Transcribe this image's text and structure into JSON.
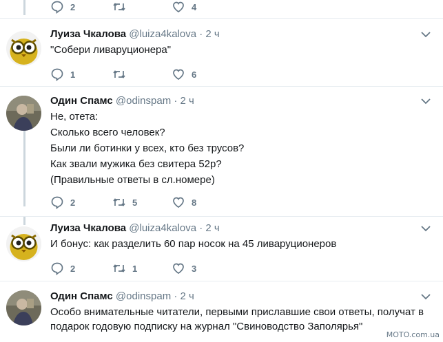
{
  "top_actions": {
    "replies": "2",
    "retweets": "",
    "likes": "4"
  },
  "tweets": [
    {
      "name": "Луиза Чкалова",
      "handle": "@luiza4kalova",
      "dot": "·",
      "time": "2 ч",
      "lines": [
        "\"Собери ливаруционера\""
      ],
      "replies": "1",
      "retweets": "",
      "likes": "6",
      "avatar": "owl-avatar"
    },
    {
      "name": "Один Спамс",
      "handle": "@odinspam",
      "dot": "·",
      "time": "2 ч",
      "lines": [
        "Не, отета:",
        "Сколько всего человек?",
        "Были ли ботинки у всех, кто без трусов?",
        "Как звали мужика без свитера 52р?",
        "(Правильные ответы в сл.номере)"
      ],
      "replies": "2",
      "retweets": "5",
      "likes": "8",
      "avatar": "painting-avatar"
    },
    {
      "name": "Луиза Чкалова",
      "handle": "@luiza4kalova",
      "dot": "·",
      "time": "2 ч",
      "lines": [
        "И бонус: как разделить 60 пар носок на 45 ливаруционеров"
      ],
      "replies": "2",
      "retweets": "1",
      "likes": "3",
      "avatar": "owl-avatar"
    },
    {
      "name": "Один Спамс",
      "handle": "@odinspam",
      "dot": "·",
      "time": "2 ч",
      "lines": [
        "Особо внимательные читатели, первыми приславшие свои ответы, получат в",
        "подарок годовую подписку на журнал \"Свиноводство Заполярья\""
      ],
      "avatar": "painting-avatar"
    }
  ],
  "watermark": "MOTO.com.ua",
  "colors": {
    "text": "#14171a",
    "muted": "#657786",
    "border": "#e6ecf0",
    "thread": "#ccd6dd"
  }
}
